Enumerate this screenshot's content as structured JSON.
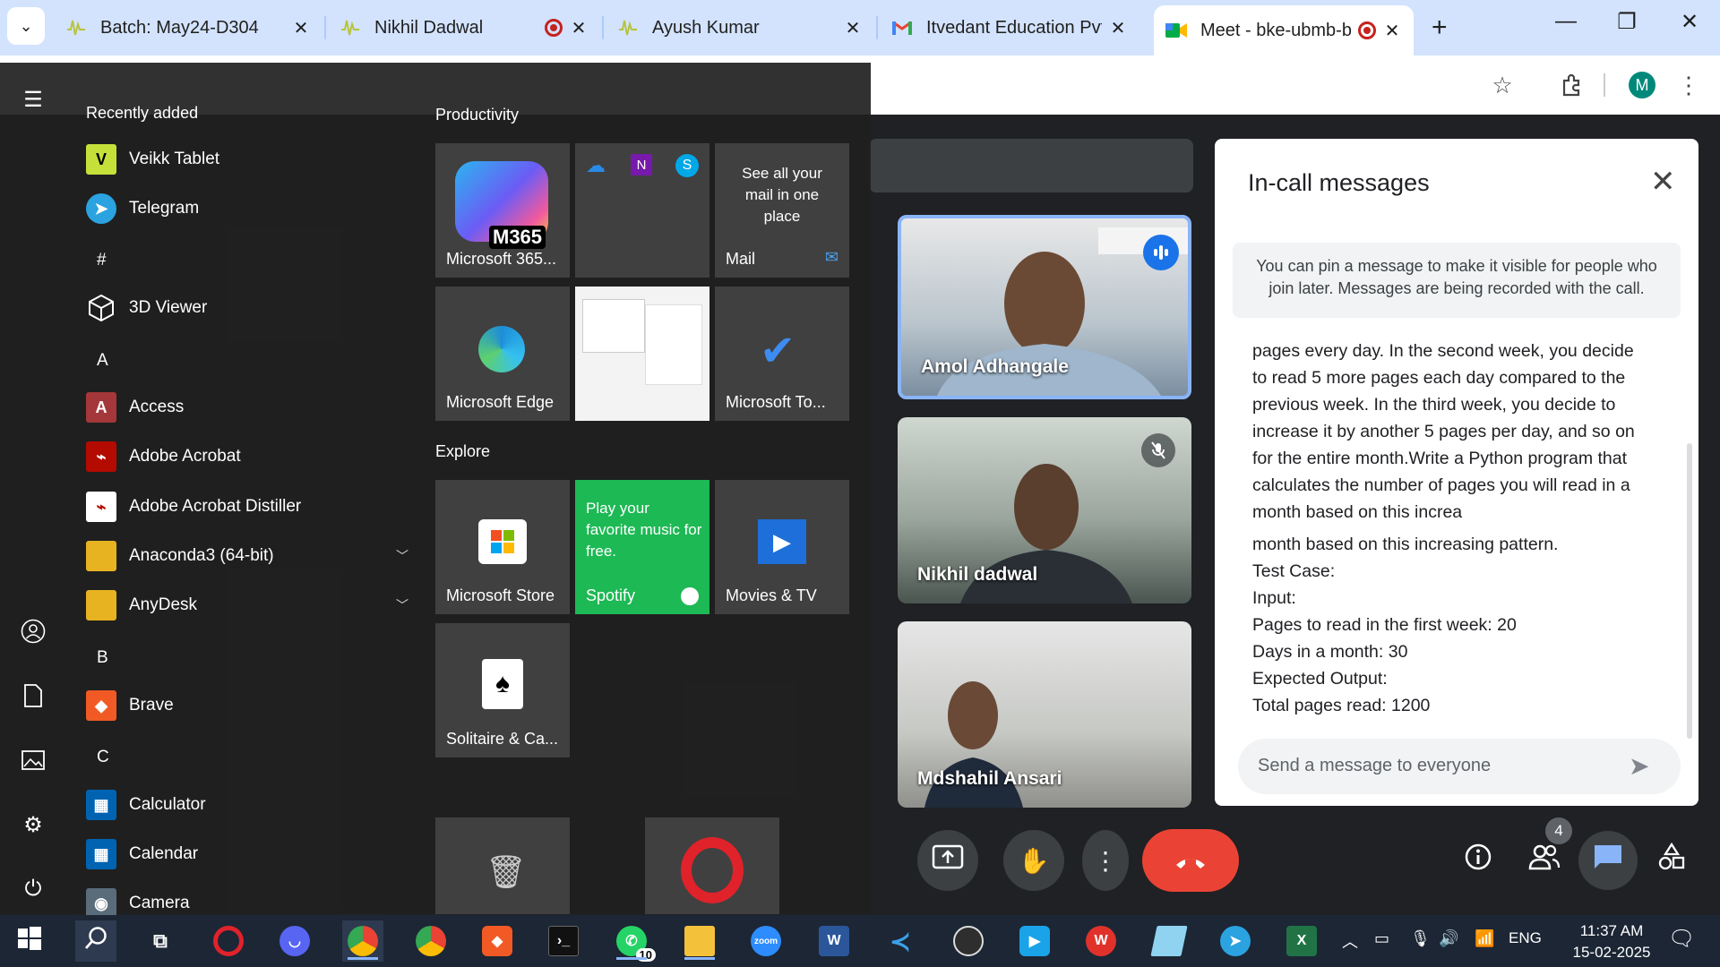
{
  "chrome": {
    "tabs": [
      {
        "label": "Batch: May24-D304",
        "icon": "waveform-icon",
        "recording": false,
        "active": false
      },
      {
        "label": "Nikhil Dadwal",
        "icon": "waveform-icon",
        "recording": true,
        "active": false
      },
      {
        "label": "Ayush Kumar",
        "icon": "waveform-icon",
        "recording": false,
        "active": false
      },
      {
        "label": "Itvedant Education Pvt. Lt",
        "icon": "gmail-icon",
        "recording": false,
        "active": false
      },
      {
        "label": "Meet - bke-ubmb-bmd",
        "icon": "meet-icon",
        "recording": true,
        "active": true
      }
    ],
    "new_tab": "+",
    "profile_letter": "M",
    "window_controls": {
      "minimize": "—",
      "restore": "❐",
      "close": "✕"
    }
  },
  "meet": {
    "participants": [
      {
        "name": "Amol Adhangale",
        "speaking": true
      },
      {
        "name": "Nikhil dadwal",
        "muted": true
      },
      {
        "name": "Mdshahil Ansari"
      }
    ],
    "panel": {
      "title": "In-call messages",
      "pin_note": "You can pin a message to make it visible for people who join later. Messages are being recorded with the call.",
      "message_lines": [
        "pages every day. In the second week, you decide",
        "to read 5 more pages each day compared to the",
        "previous week. In the third week, you decide to",
        "increase it by another 5 pages per day, and so on",
        "for the entire month.Write a Python program that",
        "calculates the number of pages you will read in a",
        "month based on this increa"
      ],
      "message2_lines": [
        "month based on this increasing pattern.",
        "Test Case:",
        "Input:",
        "Pages to read in the first week: 20",
        "Days in a month: 30",
        "Expected Output:",
        "Total pages read: 1200"
      ],
      "input_placeholder": "Send a message to everyone"
    },
    "participant_count": "4"
  },
  "start_menu": {
    "recently_added_label": "Recently added",
    "recent": [
      {
        "label": "Veikk Tablet",
        "icon": "veikk-icon",
        "color": "#c6e03a"
      },
      {
        "label": "Telegram",
        "icon": "telegram-icon",
        "color": "#2aa3e0"
      }
    ],
    "groups": [
      {
        "letter": "#",
        "apps": [
          {
            "label": "3D Viewer",
            "icon": "cube-icon",
            "color": "#ffffff"
          }
        ]
      },
      {
        "letter": "A",
        "apps": [
          {
            "label": "Access",
            "icon": "access-icon",
            "color": "#a4373a"
          },
          {
            "label": "Adobe Acrobat",
            "icon": "acrobat-icon",
            "color": "#b30b00"
          },
          {
            "label": "Adobe Acrobat Distiller",
            "icon": "acrobat-distiller-icon",
            "color": "#b30b00"
          },
          {
            "label": "Anaconda3 (64-bit)",
            "icon": "folder-icon",
            "color": "#e8b321",
            "expandable": true
          },
          {
            "label": "AnyDesk",
            "icon": "folder-icon",
            "color": "#e8b321",
            "expandable": true
          }
        ]
      },
      {
        "letter": "B",
        "apps": [
          {
            "label": "Brave",
            "icon": "brave-icon",
            "color": "#f15a24"
          }
        ]
      },
      {
        "letter": "C",
        "apps": [
          {
            "label": "Calculator",
            "icon": "calculator-icon",
            "color": "#0063b1"
          },
          {
            "label": "Calendar",
            "icon": "calendar-icon",
            "color": "#0063b1"
          },
          {
            "label": "Camera",
            "icon": "camera-icon",
            "color": "#5a6b7a"
          }
        ]
      }
    ],
    "productivity_label": "Productivity",
    "explore_label": "Explore",
    "tiles": {
      "m365": {
        "label": "Microsoft 365...",
        "badge": "M365"
      },
      "mail_text": "See all your mail in one place",
      "mail_label": "Mail",
      "edge": "Microsoft Edge",
      "todo": "Microsoft To...",
      "store": "Microsoft Store",
      "spotify_text": "Play your favorite music for free.",
      "spotify_label": "Spotify",
      "movies": "Movies & TV",
      "solitaire": "Solitaire & Ca..."
    }
  },
  "taskbar": {
    "whatsapp_badge": "10",
    "lang": "ENG",
    "time": "11:37 AM",
    "date": "15-02-2025",
    "zoom_label": "zoom"
  },
  "colors": {
    "meet_bg": "#202124",
    "end_call": "#ea4335",
    "spotify": "#1db954",
    "chrome_tabstrip": "#d3e3fd"
  }
}
